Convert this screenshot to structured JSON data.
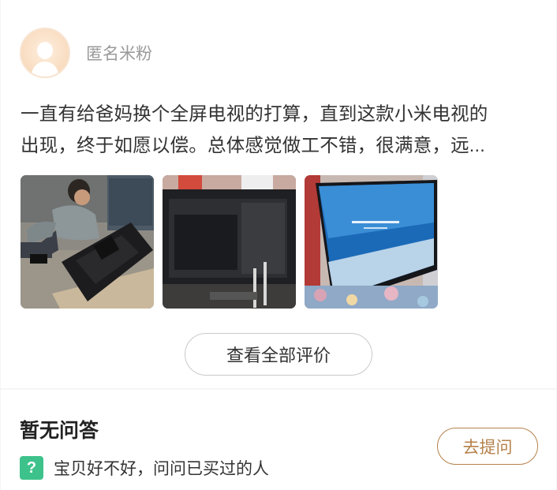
{
  "review": {
    "user_name": "匿名米粉",
    "text_line1": "一直有给爸妈换个全屏电视的打算，直到这款小米电视的",
    "text_line2": "出现，终于如愿以偿。总体感觉做工不错，很满意，远...",
    "photos": [
      {
        "icon": "photo-installing-tv-stand"
      },
      {
        "icon": "photo-tv-back-panel"
      },
      {
        "icon": "photo-tv-powered-on"
      }
    ],
    "view_all_label": "查看全部评价"
  },
  "qa": {
    "title": "暂无问答",
    "badge": "?",
    "hint": "宝贝好不好，问问已买过的人",
    "ask_label": "去提问",
    "accent_color": "#b5814b",
    "badge_color": "#3ec28b"
  }
}
